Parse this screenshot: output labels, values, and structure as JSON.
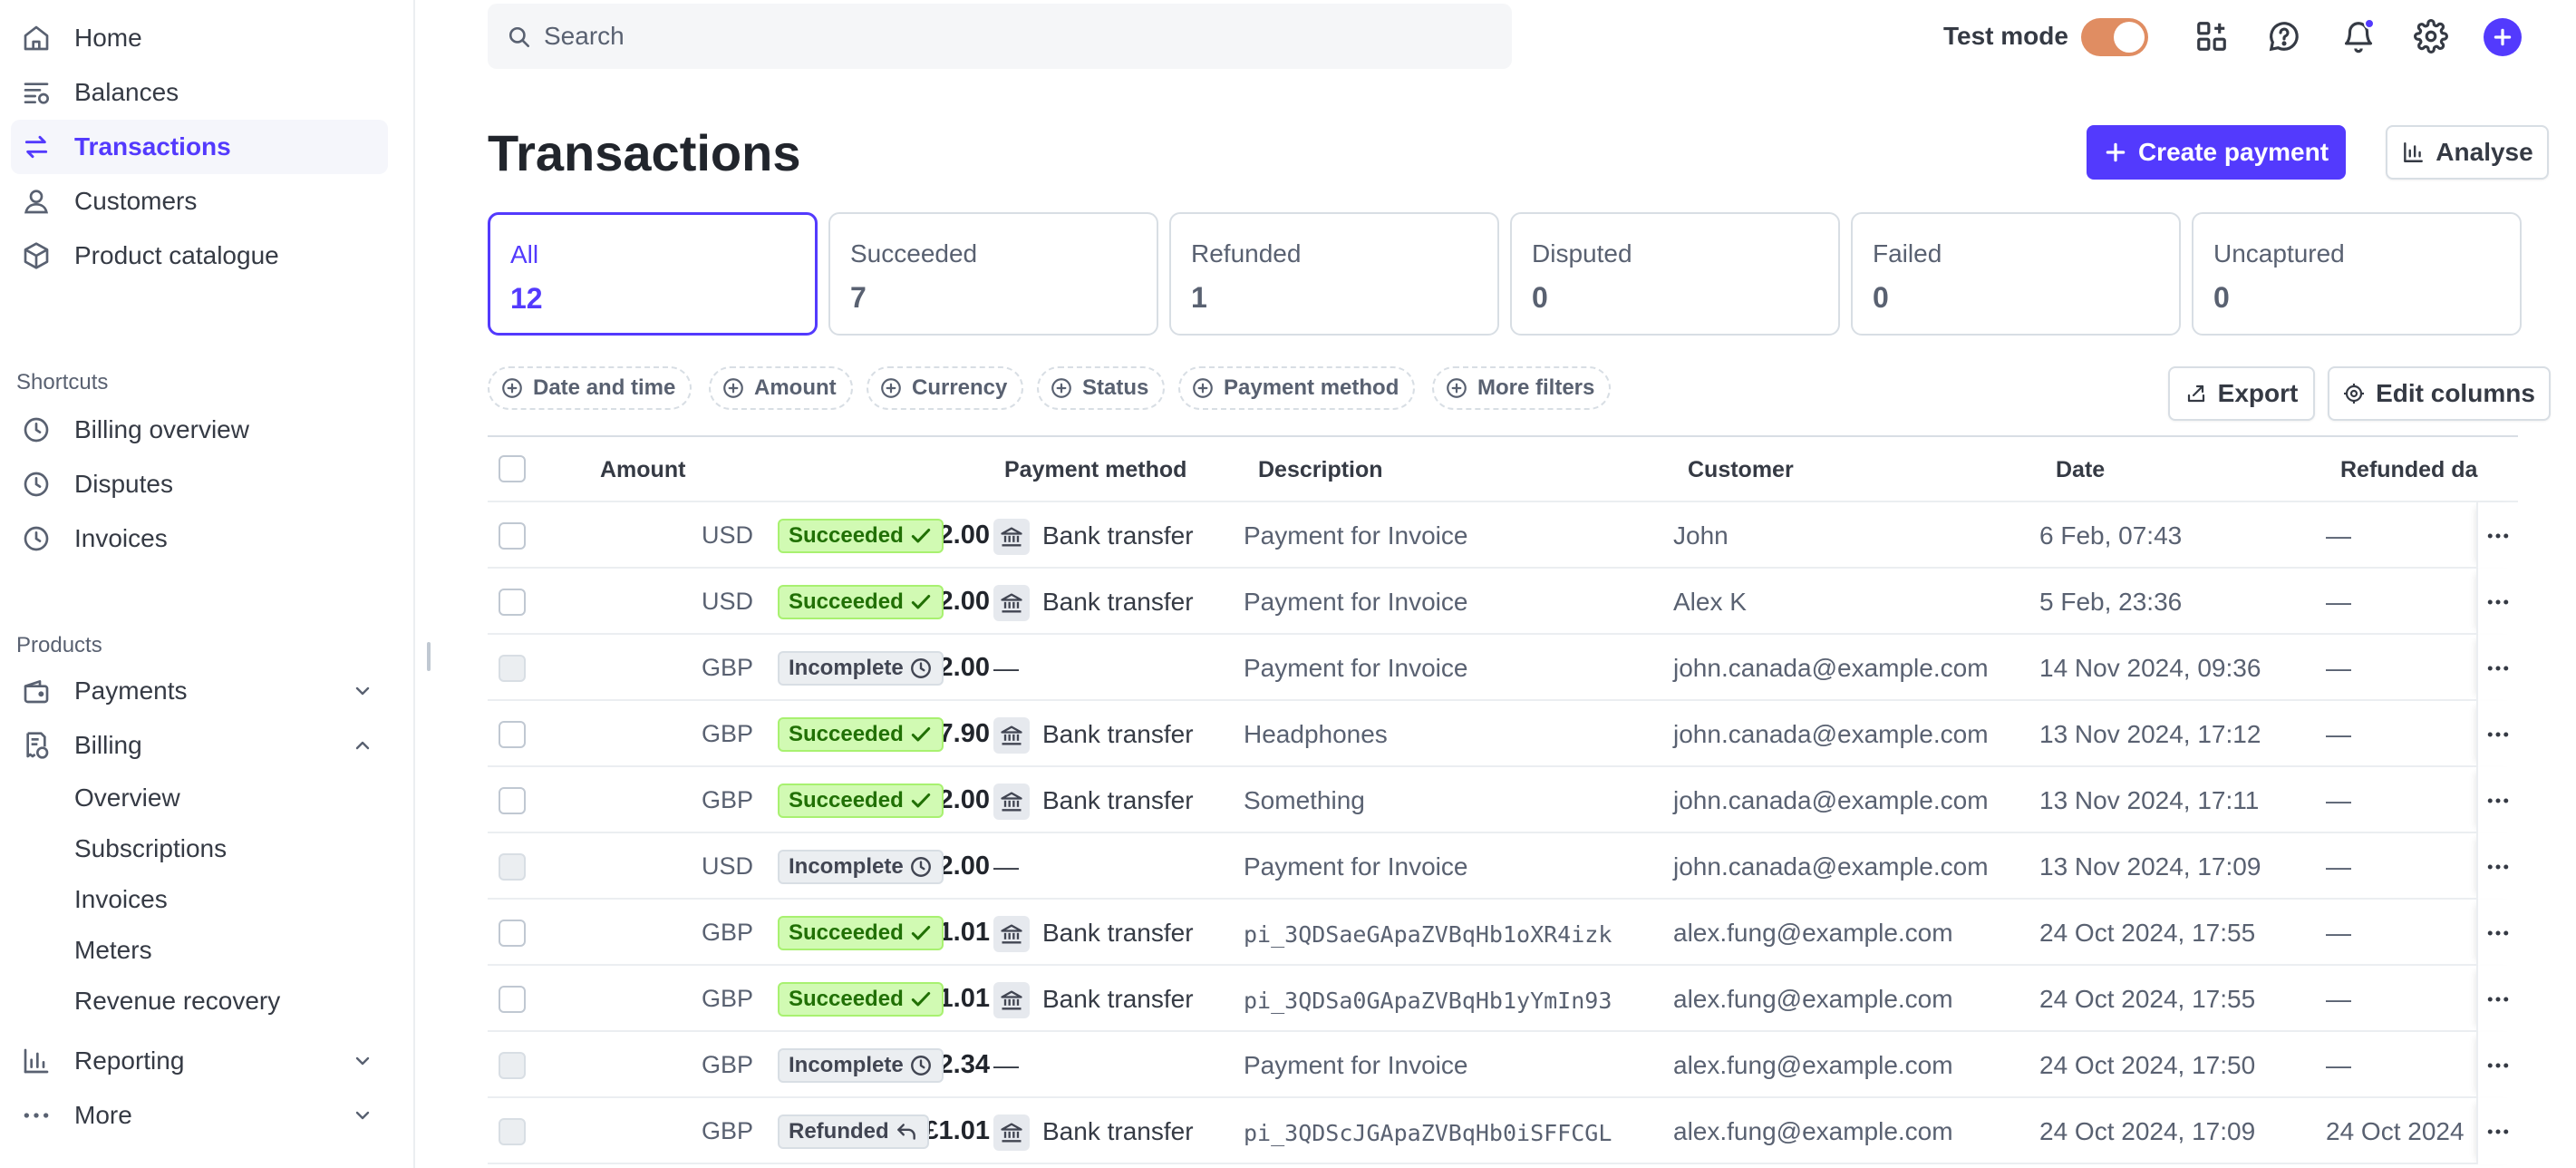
{
  "sidebar": {
    "nav": [
      {
        "label": "Home",
        "icon": "home-icon"
      },
      {
        "label": "Balances",
        "icon": "balances-icon"
      },
      {
        "label": "Transactions",
        "icon": "transactions-icon",
        "active": true
      },
      {
        "label": "Customers",
        "icon": "customers-icon"
      },
      {
        "label": "Product catalogue",
        "icon": "product-icon"
      }
    ],
    "shortcuts_label": "Shortcuts",
    "shortcuts": [
      {
        "label": "Billing overview",
        "icon": "clock-icon"
      },
      {
        "label": "Disputes",
        "icon": "clock-icon"
      },
      {
        "label": "Invoices",
        "icon": "clock-icon"
      }
    ],
    "products_label": "Products",
    "products": [
      {
        "label": "Payments",
        "icon": "wallet-icon",
        "expanded": false
      },
      {
        "label": "Billing",
        "icon": "billing-icon",
        "expanded": true
      },
      {
        "label": "Reporting",
        "icon": "reporting-icon",
        "expanded": false
      },
      {
        "label": "More",
        "icon": "more-icon",
        "expanded": false
      }
    ],
    "billing_sub": [
      "Overview",
      "Subscriptions",
      "Invoices",
      "Meters",
      "Revenue recovery"
    ]
  },
  "topbar": {
    "search_placeholder": "Search",
    "test_mode_label": "Test mode",
    "test_mode_on": true
  },
  "header": {
    "title": "Transactions",
    "create_payment_label": "Create payment",
    "analyse_label": "Analyse"
  },
  "status_cards": [
    {
      "label": "All",
      "count": "12",
      "active": true
    },
    {
      "label": "Succeeded",
      "count": "7"
    },
    {
      "label": "Refunded",
      "count": "1"
    },
    {
      "label": "Disputed",
      "count": "0"
    },
    {
      "label": "Failed",
      "count": "0"
    },
    {
      "label": "Uncaptured",
      "count": "0"
    }
  ],
  "filters": [
    "Date and time",
    "Amount",
    "Currency",
    "Status",
    "Payment method",
    "More filters"
  ],
  "export_label": "Export",
  "edit_columns_label": "Edit columns",
  "table": {
    "columns": {
      "amount": "Amount",
      "payment_method": "Payment method",
      "description": "Description",
      "customer": "Customer",
      "date": "Date",
      "refunded_date": "Refunded da"
    },
    "rows": [
      {
        "amount": "US$22.00",
        "currency": "USD",
        "status": "Succeeded",
        "payment_method": "Bank transfer",
        "description": "Payment for Invoice",
        "mono": false,
        "customer": "John",
        "date": "6 Feb, 07:43",
        "refunded_date": "—"
      },
      {
        "amount": "US$22.00",
        "currency": "USD",
        "status": "Succeeded",
        "payment_method": "Bank transfer",
        "description": "Payment for Invoice",
        "mono": false,
        "customer": "Alex K",
        "date": "5 Feb, 23:36",
        "refunded_date": "—"
      },
      {
        "amount": "£22.00",
        "currency": "GBP",
        "status": "Incomplete",
        "payment_method": "—",
        "description": "Payment for Invoice",
        "mono": false,
        "customer": "john.canada@example.com",
        "date": "14 Nov 2024, 09:36",
        "refunded_date": "—"
      },
      {
        "amount": "£97.90",
        "currency": "GBP",
        "status": "Succeeded",
        "payment_method": "Bank transfer",
        "description": "Headphones",
        "mono": false,
        "customer": "john.canada@example.com",
        "date": "13 Nov 2024, 17:12",
        "refunded_date": "—"
      },
      {
        "amount": "£2.00",
        "currency": "GBP",
        "status": "Succeeded",
        "payment_method": "Bank transfer",
        "description": "Something",
        "mono": false,
        "customer": "john.canada@example.com",
        "date": "13 Nov 2024, 17:11",
        "refunded_date": "—"
      },
      {
        "amount": "US$22.00",
        "currency": "USD",
        "status": "Incomplete",
        "payment_method": "—",
        "description": "Payment for Invoice",
        "mono": false,
        "customer": "john.canada@example.com",
        "date": "13 Nov 2024, 17:09",
        "refunded_date": "—"
      },
      {
        "amount": "£1.01",
        "currency": "GBP",
        "status": "Succeeded",
        "payment_method": "Bank transfer",
        "description": "pi_3QDSaeGApaZVBqHb1oXR4izk",
        "mono": true,
        "customer": "alex.fung@example.com",
        "date": "24 Oct 2024, 17:55",
        "refunded_date": "—"
      },
      {
        "amount": "£1.01",
        "currency": "GBP",
        "status": "Succeeded",
        "payment_method": "Bank transfer",
        "description": "pi_3QDSa0GApaZVBqHb1yYmIn93",
        "mono": true,
        "customer": "alex.fung@example.com",
        "date": "24 Oct 2024, 17:55",
        "refunded_date": "—"
      },
      {
        "amount": "£12.34",
        "currency": "GBP",
        "status": "Incomplete",
        "payment_method": "—",
        "description": "Payment for Invoice",
        "mono": false,
        "customer": "alex.fung@example.com",
        "date": "24 Oct 2024, 17:50",
        "refunded_date": "—"
      },
      {
        "amount": "£1.01",
        "currency": "GBP",
        "status": "Refunded",
        "payment_method": "Bank transfer",
        "description": "pi_3QDScJGApaZVBqHb0iSFFCGL",
        "mono": true,
        "customer": "alex.fung@example.com",
        "date": "24 Oct 2024, 17:09",
        "refunded_date": "24 Oct 2024"
      }
    ]
  },
  "colors": {
    "accent": "#533afd",
    "succeeded_bg": "#d1fab3",
    "succeeded_text": "#217005",
    "toggle_on": "#e08d62"
  }
}
